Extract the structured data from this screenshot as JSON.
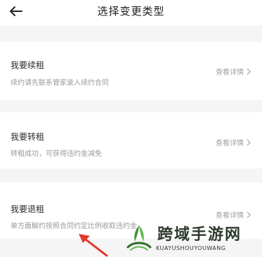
{
  "header": {
    "title": "选择变更类型",
    "back_icon": "arrow-left-icon"
  },
  "options": [
    {
      "title": "我要续租",
      "description": "续约请先联系管家录入续约合同",
      "detail_label": "查看详情"
    },
    {
      "title": "我要转租",
      "description": "转租成功，可获得违约金减免",
      "detail_label": "查看详情"
    },
    {
      "title": "我要退租",
      "description": "单方面解约按照合同约定比例收取违约金",
      "detail_label": "查看详情"
    }
  ],
  "watermark": {
    "name": "跨域手游网",
    "subtitle": "KUAYUSHOUYOUWANG"
  },
  "colors": {
    "background": "#f5f5f5",
    "card": "#ffffff",
    "annotation_arrow": "#e03a2f"
  }
}
